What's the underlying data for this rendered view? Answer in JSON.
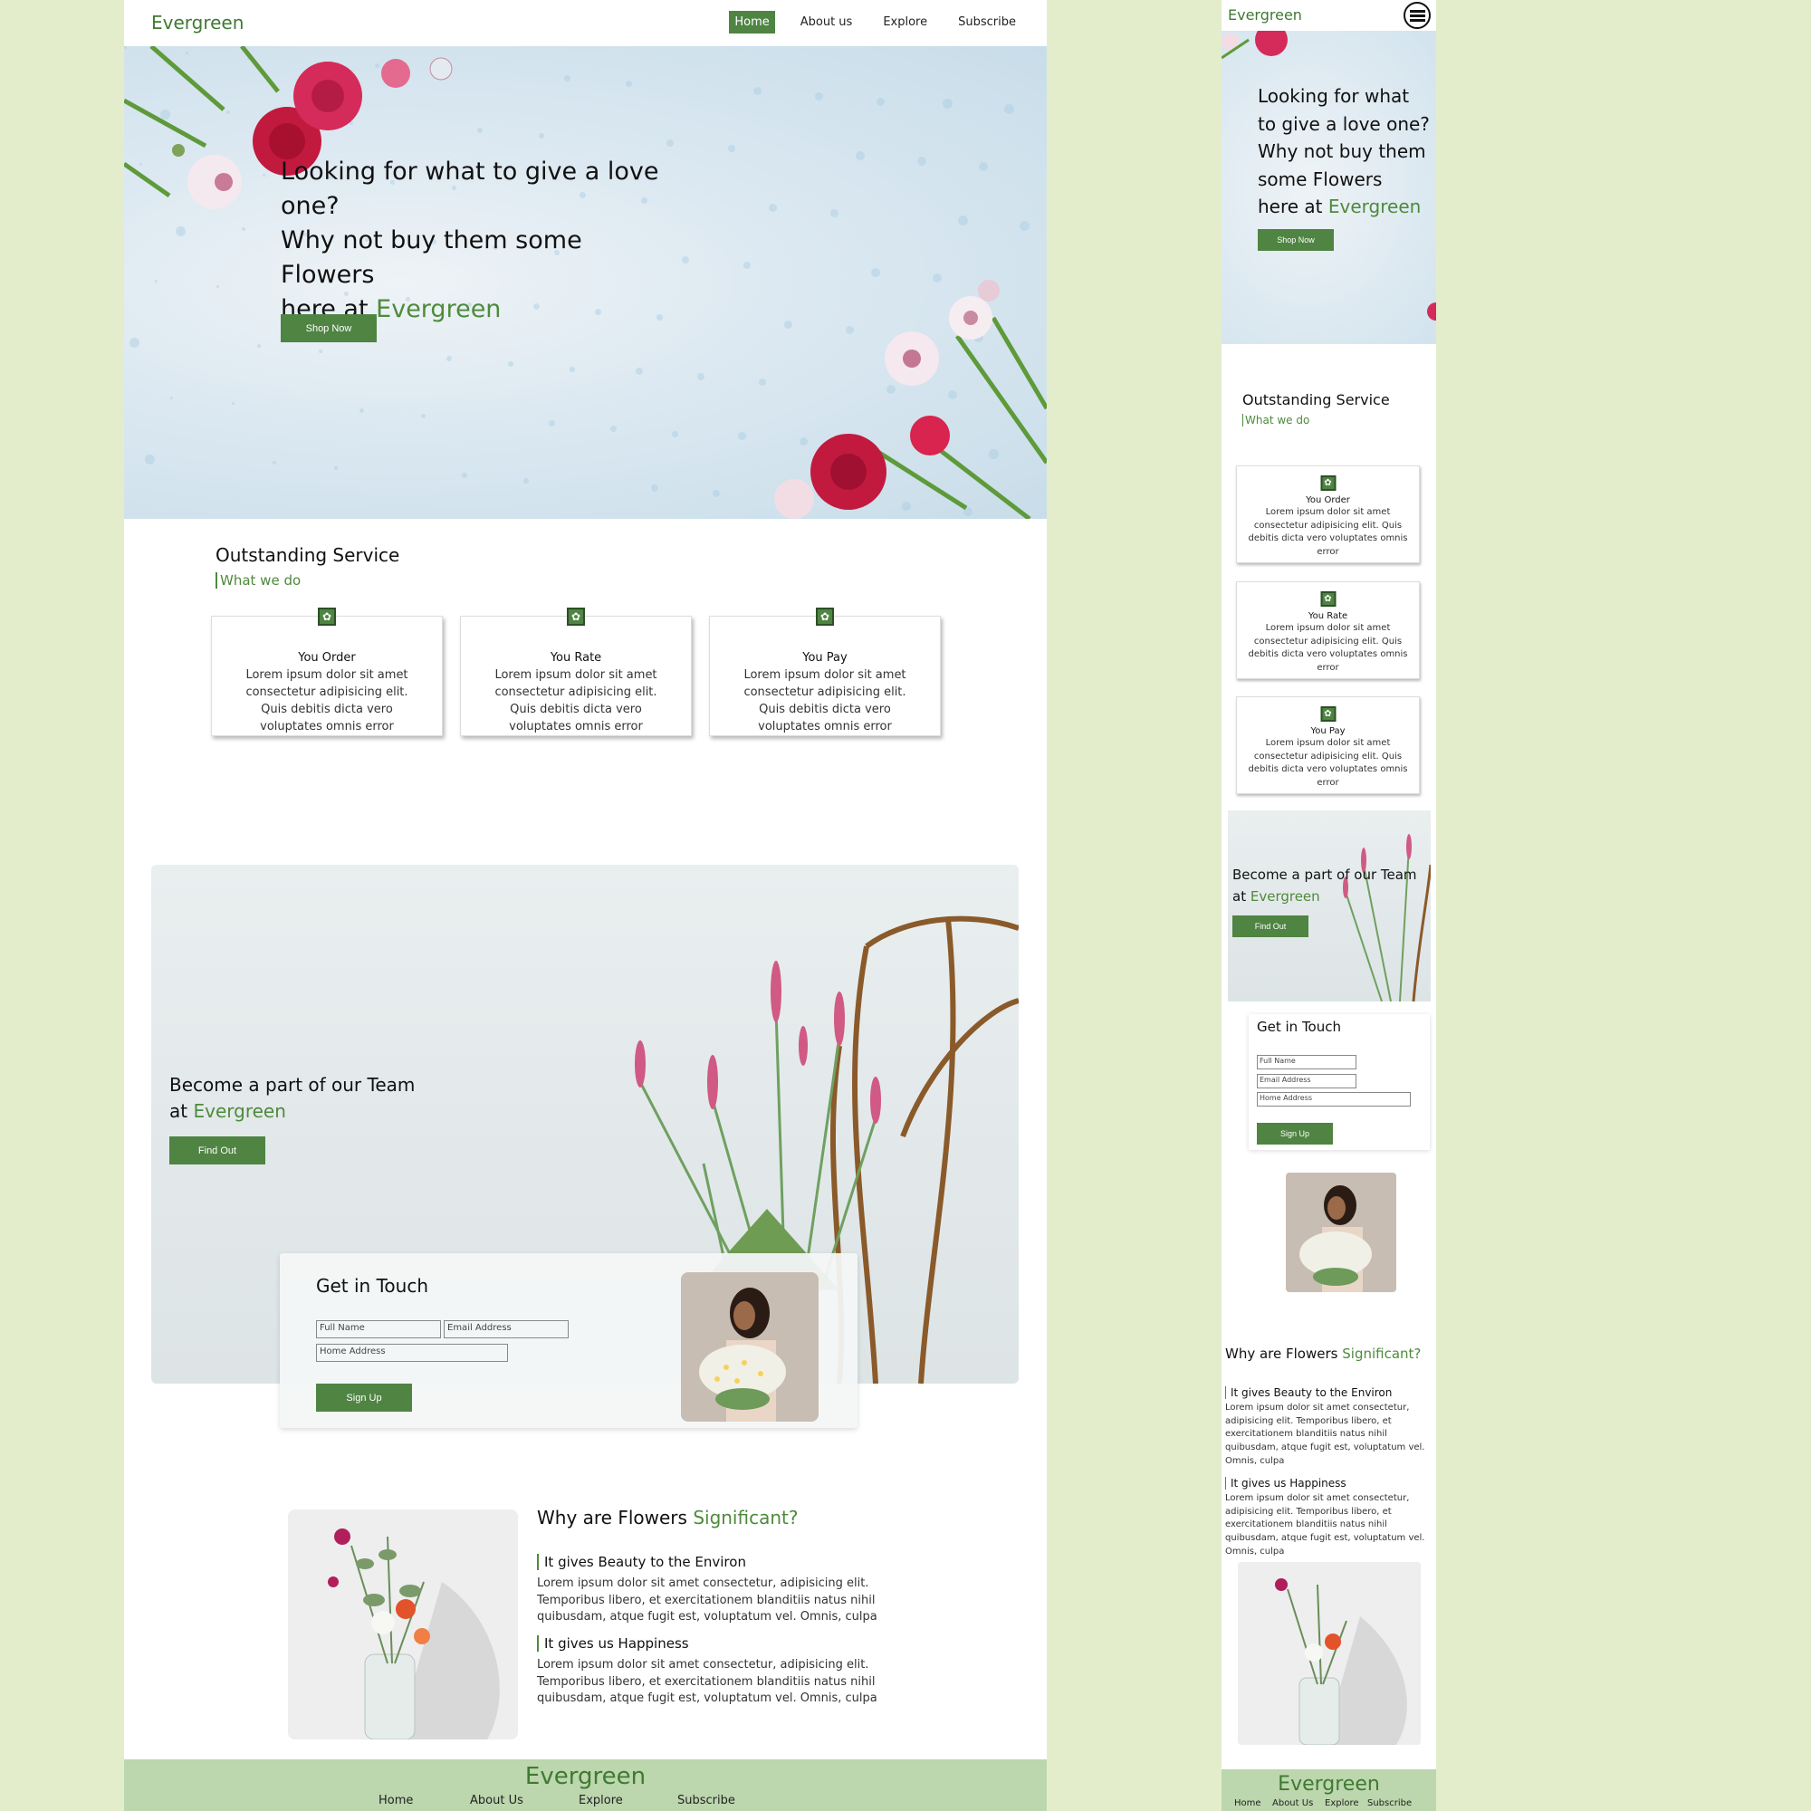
{
  "brand": {
    "name": "Evergreen",
    "accent": "#4f8443",
    "page_bg": "#e3edcc",
    "footer_bg": "#bcd6ad"
  },
  "nav": {
    "items": [
      {
        "label": "Home",
        "active": true
      },
      {
        "label": "About us"
      },
      {
        "label": "Explore"
      },
      {
        "label": "Subscribe"
      }
    ]
  },
  "hero": {
    "line1": "Looking for what to give a love one?",
    "line2": "Why not buy them some Flowers",
    "line3_prefix": "here at",
    "line3_brand": "Evergreen",
    "button": "Shop Now"
  },
  "service": {
    "title": "Outstanding Service",
    "subtitle": "What we do",
    "cards": [
      {
        "title": "You Order",
        "body": "Lorem ipsum dolor sit amet consectetur adipisicing elit. Quis debitis dicta vero voluptates omnis error",
        "icon": "flower-icon"
      },
      {
        "title": "You Rate",
        "body": "Lorem ipsum dolor sit amet consectetur adipisicing elit. Quis debitis dicta vero voluptates omnis error",
        "icon": "flower-icon"
      },
      {
        "title": "You Pay",
        "body": "Lorem ipsum dolor sit amet consectetur adipisicing elit. Quis debitis dicta vero voluptates omnis error",
        "icon": "flower-icon"
      }
    ]
  },
  "team": {
    "line1": "Become a part of our Team",
    "line2_prefix": "at",
    "line2_brand": "Evergreen",
    "button": "Find Out"
  },
  "contact": {
    "title": "Get in Touch",
    "full_name_placeholder": "Full Name",
    "email_placeholder": "Email Address",
    "address_placeholder": "Home Address",
    "button": "Sign Up"
  },
  "why": {
    "title_prefix": "Why are Flowers",
    "title_accent": "Significant?",
    "points": [
      {
        "title": "It gives Beauty to the Environ",
        "body": "Lorem ipsum dolor sit amet consectetur, adipisicing elit. Temporibus libero, et exercitationem blanditiis natus nihil quibusdam, atque fugit est, voluptatum vel. Omnis, culpa"
      },
      {
        "title": "It gives us Happiness",
        "body": "Lorem ipsum dolor sit amet consectetur, adipisicing elit. Temporibus libero, et exercitationem blanditiis natus nihil quibusdam, atque fugit est, voluptatum vel. Omnis, culpa"
      }
    ]
  },
  "footer": {
    "brand": "Evergreen",
    "links": [
      "Home",
      "About Us",
      "Explore",
      "Subscribe"
    ]
  }
}
